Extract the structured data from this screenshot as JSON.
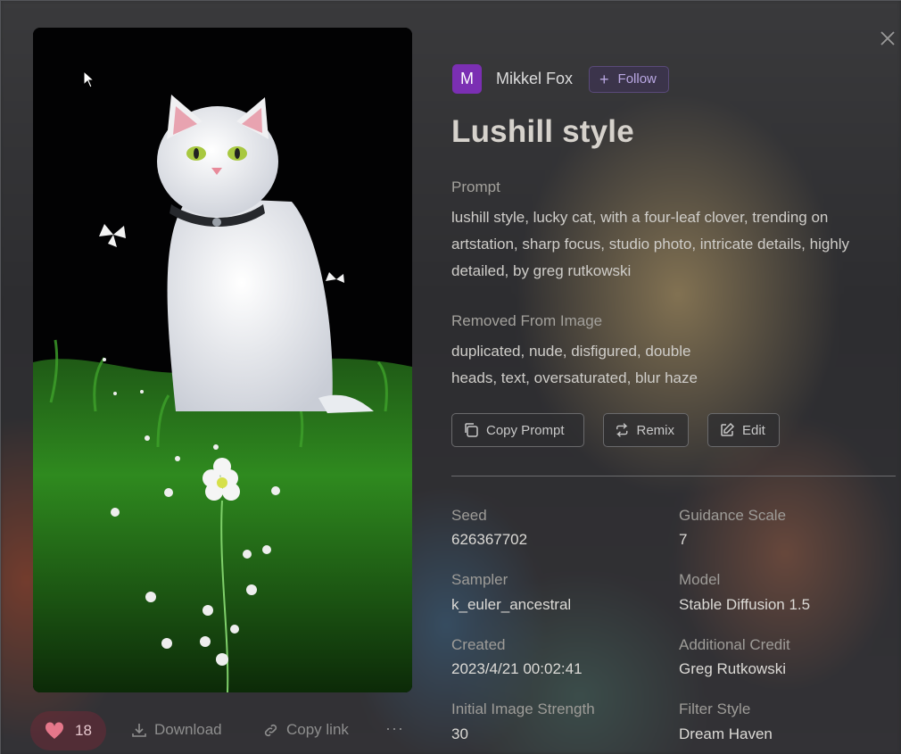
{
  "author": {
    "initial": "M",
    "name": "Mikkel Fox",
    "follow_label": "Follow"
  },
  "title": "Lushill style",
  "prompt": {
    "label": "Prompt",
    "line1": "lushill style, lucky cat, with a four-leaf clover, trending on",
    "line2": "artstation, sharp focus, studio photo, intricate details, highly",
    "line3": "detailed, by greg rutkowski"
  },
  "negative": {
    "label": "Removed From Image",
    "line1": "duplicated, nude, disfigured, double",
    "line2": "heads, text, oversaturated, blur haze"
  },
  "actions": {
    "copy_prompt": "Copy Prompt",
    "remix": "Remix",
    "edit": "Edit"
  },
  "meta": {
    "seed_label": "Seed",
    "seed": "626367702",
    "guidance_label": "Guidance Scale",
    "guidance": "7",
    "sampler_label": "Sampler",
    "sampler": "k_euler_ancestral",
    "model_label": "Model",
    "model": "Stable Diffusion 1.5",
    "created_label": "Created",
    "created": "2023/4/21 00:02:41",
    "credit_label": "Additional Credit",
    "credit": "Greg Rutkowski",
    "strength_label": "Initial Image Strength",
    "strength": "30",
    "filter_label": "Filter Style",
    "filter": "Dream Haven"
  },
  "bottom": {
    "likes": "18",
    "download": "Download",
    "copy_link": "Copy link",
    "more": "···"
  },
  "colors": {
    "avatar": "#7b2fb3",
    "follow": "#b9a7e2",
    "like": "#e5778a"
  }
}
